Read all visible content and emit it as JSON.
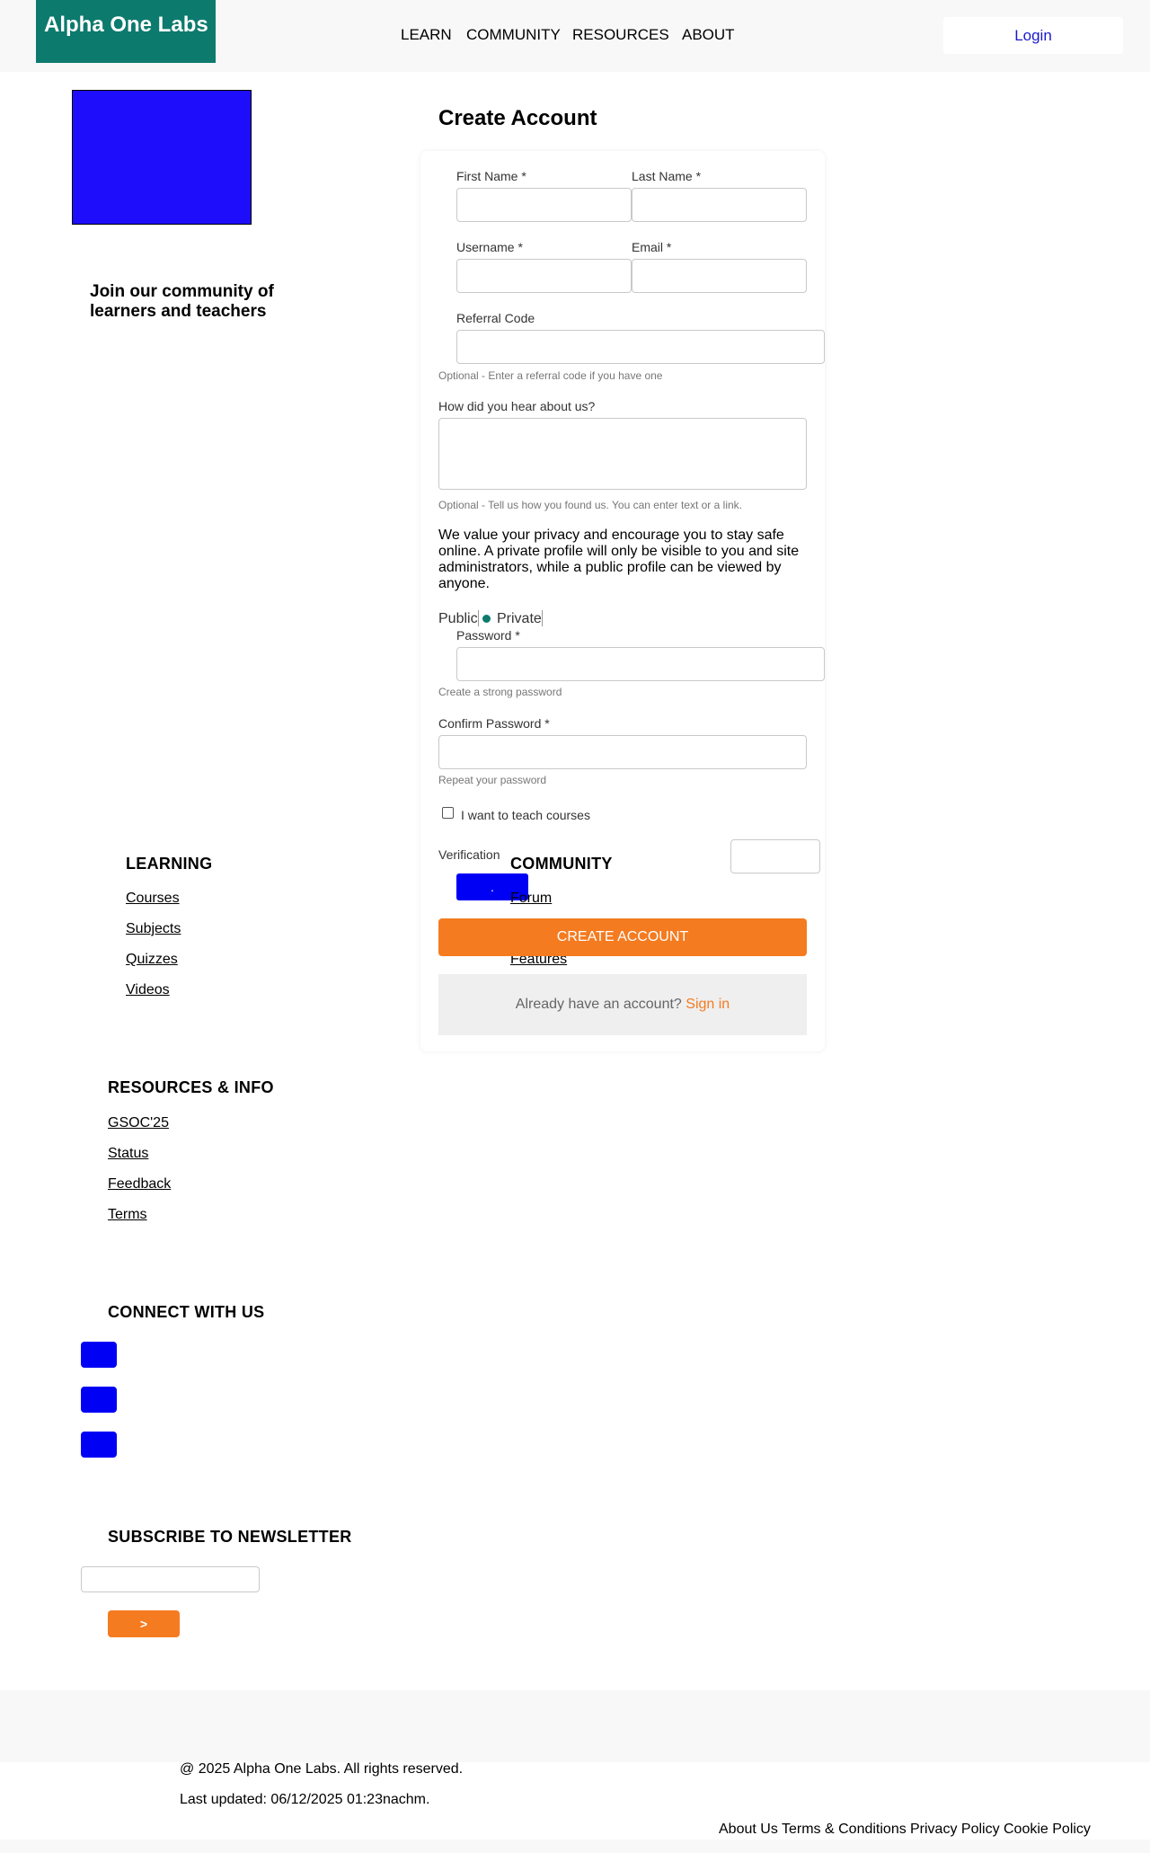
{
  "header": {
    "logo_text": "Alpha One Labs",
    "nav": [
      "LEARN",
      "COMMUNITY",
      "RESOURCES",
      "ABOUT"
    ],
    "login_label": "Login"
  },
  "hero": {
    "tagline": "Join our community of learners and teachers"
  },
  "form": {
    "title": "Create Account",
    "first_name_label": "First Name *",
    "last_name_label": "Last Name *",
    "username_label": "Username *",
    "email_label": "Email *",
    "referral_label": "Referral Code",
    "referral_help": "Optional - Enter a referral code if you have one",
    "hear_label": "How did you hear about us?",
    "hear_help": "Optional - Tell us how you found us. You can enter text or a link.",
    "privacy_text": "We value your privacy and encourage you to stay safe online. A private profile will only be visible to you and site administrators, while a public profile can be viewed by anyone.",
    "visibility_public": "Public",
    "visibility_private": "Private",
    "password_label": "Password *",
    "password_help": "Create a strong password",
    "confirm_label": "Confirm Password *",
    "confirm_help": "Repeat your password",
    "teach_label": "I want to teach courses",
    "verification_label": "Verification",
    "captcha_button": ".",
    "create_button": "CREATE ACCOUNT",
    "signin_prompt": "Already have an account?",
    "signin_link": "Sign in"
  },
  "footer": {
    "learning_heading": "LEARNING",
    "learning_links": [
      "Courses",
      "Subjects",
      "Quizzes",
      "Videos"
    ],
    "community_heading": "COMMUNITY",
    "community_links": [
      "Forum",
      "Features"
    ],
    "resources_heading": "RESOURCES & INFO",
    "resources_links": [
      "GSOC'25",
      "Status",
      "Feedback",
      "Terms"
    ],
    "connect_heading": "CONNECT WITH US",
    "newsletter_heading": "SUBSCRIBE TO NEWSLETTER",
    "newsletter_button": ">",
    "copyright": "@ 2025 Alpha One Labs. All rights reserved.",
    "last_updated": "Last updated: 06/12/2025 01:23nachm.",
    "legal_links": [
      "About Us",
      "Terms & Conditions",
      "Privacy Policy",
      "Cookie Policy"
    ]
  },
  "colors": {
    "brand_teal": "#0d7a6e",
    "accent_orange": "#f47b20",
    "placeholder_blue": "#0000f5"
  }
}
